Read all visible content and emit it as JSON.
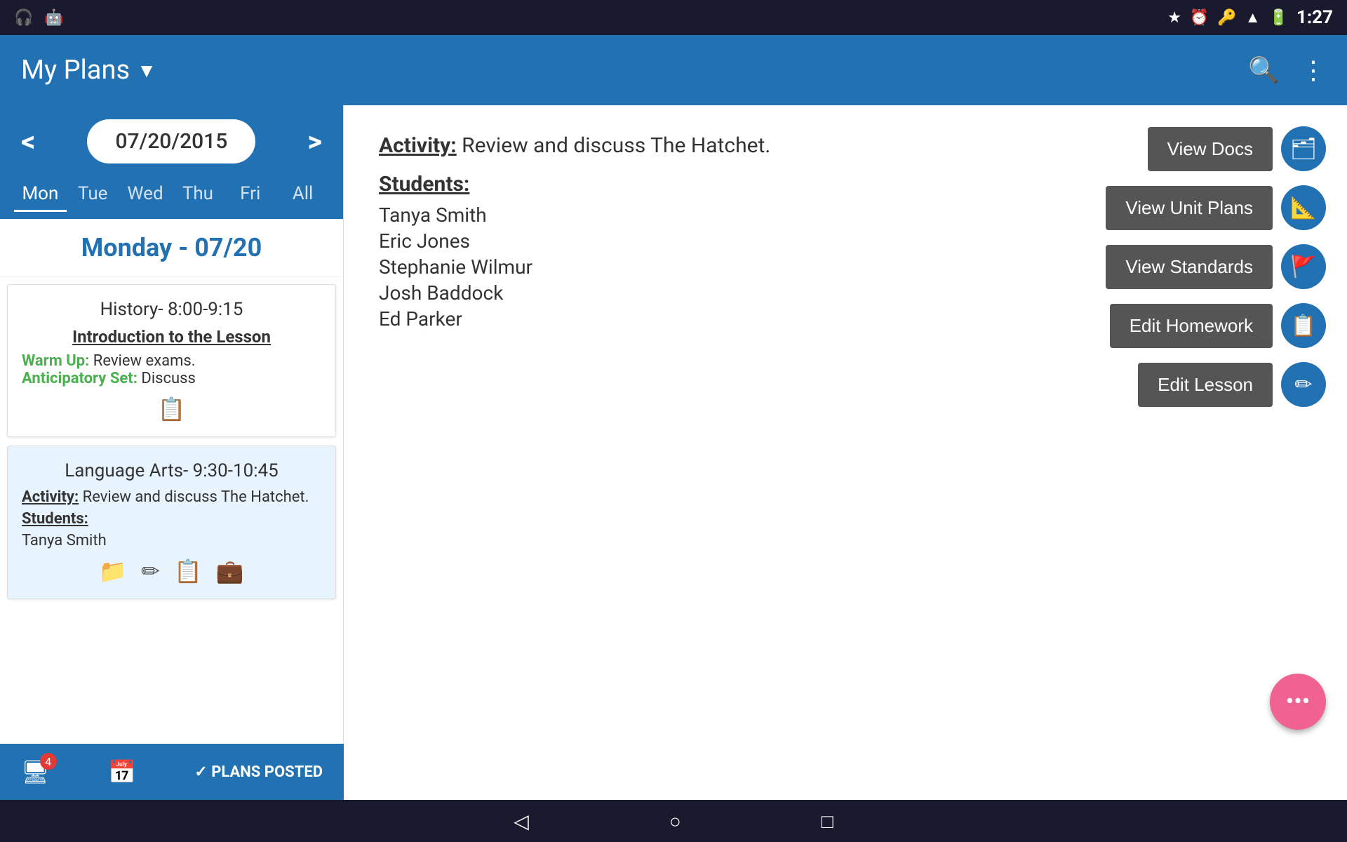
{
  "statusBar": {
    "time": "1:27",
    "icons": [
      "headphones",
      "android",
      "star",
      "alarm",
      "key",
      "wifi",
      "battery"
    ]
  },
  "appBar": {
    "title": "My Plans",
    "dropdownArrow": "▼"
  },
  "dateNav": {
    "prevArrow": "<",
    "nextArrow": ">",
    "currentDate": "07/20/2015"
  },
  "dayTabs": [
    {
      "label": "Mon",
      "active": true
    },
    {
      "label": "Tue",
      "active": false
    },
    {
      "label": "Wed",
      "active": false
    },
    {
      "label": "Thu",
      "active": false
    },
    {
      "label": "Fri",
      "active": false
    },
    {
      "label": "All",
      "active": false
    }
  ],
  "dayHeader": "Monday - 07/20",
  "lessons": [
    {
      "title": "History- 8:00-9:15",
      "subtitle": "Introduction to the Lesson",
      "warmUpLabel": "Warm Up:",
      "warmUpText": "  Review exams.",
      "anticipatoryLabel": "Anticipatory Set:",
      "anticipatoryText": "  Discuss"
    },
    {
      "title": "Language Arts- 9:30-10:45",
      "activityLabel": "Activity:",
      "activityText": " Review and discuss The Hatchet.",
      "studentsLabel": "Students:",
      "studentName": "Tanya Smith"
    }
  ],
  "detail": {
    "activityLabel": "Activity:",
    "activityText": " Review and discuss The Hatchet.",
    "studentsLabel": "Students:",
    "students": [
      "Tanya Smith",
      "Eric Jones",
      "Stephanie Wilmur",
      "Josh Baddock",
      "Ed Parker"
    ]
  },
  "actions": [
    {
      "label": "View Docs",
      "icon": "🗂"
    },
    {
      "label": "View Unit Plans",
      "icon": "📐"
    },
    {
      "label": "View Standards",
      "icon": "🚩"
    },
    {
      "label": "Edit Homework",
      "icon": "📋"
    },
    {
      "label": "Edit Lesson",
      "icon": "✏"
    }
  ],
  "bottomBar": {
    "badge": "4",
    "plansPostedIcon": "✓",
    "plansPostedText": "PLANS POSTED"
  },
  "fab": {
    "icon": "•••"
  }
}
